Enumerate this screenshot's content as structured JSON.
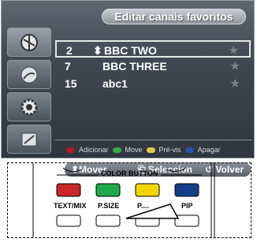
{
  "screen": {
    "title": "Editar canais favoritos",
    "sidebar_icons": [
      "satellite-dish-icon",
      "globe-icon",
      "gear-icon",
      "tools-icon"
    ],
    "channels": [
      {
        "number": "2",
        "arrows": "⬍",
        "name": "BBC TWO",
        "star": "★",
        "selected": true
      },
      {
        "number": "7",
        "arrows": "",
        "name": "BBC THREE",
        "star": "★",
        "selected": false
      },
      {
        "number": "15",
        "arrows": "",
        "name": "abc1",
        "star": "★",
        "selected": false
      }
    ],
    "legend": [
      {
        "color": "#b01b1b",
        "label": "Adicionar"
      },
      {
        "color": "#3aa84a",
        "label": "Move"
      },
      {
        "color": "#e2c94a",
        "label": "Pré-vis"
      },
      {
        "color": "#2b4eb3",
        "label": "Apagar"
      }
    ],
    "nav": {
      "move": "⬍Mover",
      "select": "⎗ Seleccion",
      "back": "↺ Volver"
    }
  },
  "remote": {
    "header": "COLOR BUTTON",
    "buttons": [
      {
        "label": "TEXT/MIX"
      },
      {
        "label": "P.SIZE"
      },
      {
        "label": "P...."
      },
      {
        "label": "PIP"
      }
    ]
  }
}
